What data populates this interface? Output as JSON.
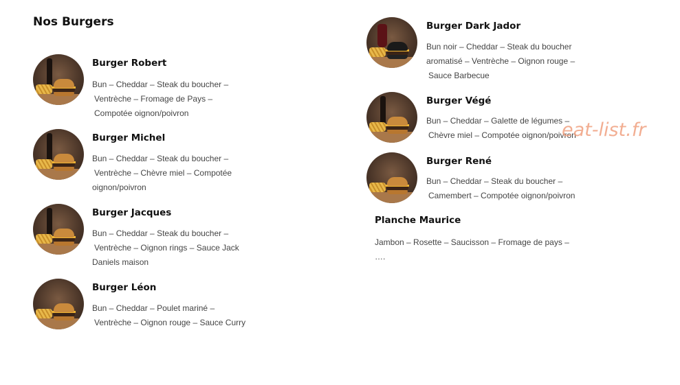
{
  "title": "Nos Burgers",
  "items": [
    {
      "name": "Burger Robert",
      "line1": "Bun – Cheddar – Steak du boucher –",
      "line2": "Ventrèche – Fromage de Pays –",
      "line3": "Compotée oignon/poivron"
    },
    {
      "name": "Burger Michel",
      "line1": "Bun – Cheddar – Steak du boucher –",
      "line2": "Ventrèche – Chèvre miel – Compotée",
      "line3": "oignon/poivron"
    },
    {
      "name": "Burger Jacques",
      "line1": "Bun – Cheddar – Steak du boucher –",
      "line2": "Ventrèche – Oignon rings – Sauce Jack",
      "line3": "Daniels maison"
    },
    {
      "name": "Burger Léon",
      "line1": "Bun – Cheddar – Poulet mariné –",
      "line2": "Ventrèche – Oignon rouge – Sauce Curry"
    },
    {
      "name": "Burger Dark Jador",
      "line1": "Bun noir – Cheddar – Steak du boucher",
      "line2": "aromatisé – Ventrèche – Oignon rouge –",
      "line3": "Sauce Barbecue"
    },
    {
      "name": "Burger Végé",
      "line1": "Bun – Cheddar – Galette de légumes –",
      "line2": "Chèvre miel – Compotée oignon/poivron"
    },
    {
      "name": "Burger René",
      "line1": "Bun – Cheddar – Steak du boucher –",
      "line2": "Camembert – Compotée oignon/poivron"
    },
    {
      "name": "Planche Maurice",
      "line1": "Jambon – Rosette – Saucisson – Fromage de pays – …."
    }
  ],
  "watermark": "eat-list.fr",
  "accent_color": "#f0a080"
}
